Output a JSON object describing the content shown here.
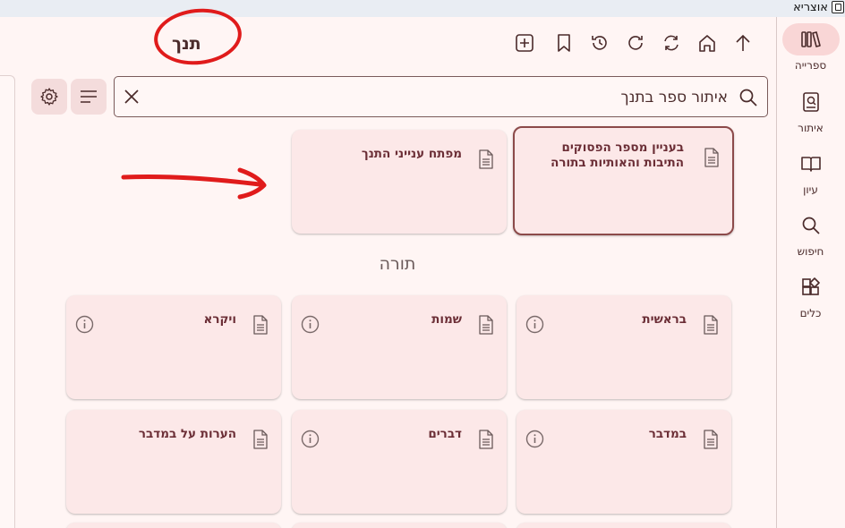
{
  "window": {
    "title": "אוצריא"
  },
  "header": {
    "title": "תנך"
  },
  "toolbar": {
    "icons": [
      "add-icon",
      "bookmark-icon",
      "history-icon",
      "refresh-icon",
      "sync-icon",
      "home-icon",
      "up-arrow-icon"
    ]
  },
  "search": {
    "placeholder": "איתור ספר בתנך"
  },
  "rail": {
    "items": [
      {
        "label": "ספרייה",
        "icon": "library-icon",
        "active": true
      },
      {
        "label": "איתור",
        "icon": "find-book-icon",
        "active": false
      },
      {
        "label": "עיון",
        "icon": "book-open-icon",
        "active": false
      },
      {
        "label": "חיפוש",
        "icon": "search-icon",
        "active": false
      },
      {
        "label": "כלים",
        "icon": "tools-icon",
        "active": false
      }
    ]
  },
  "top_cards": [
    {
      "title": "בעניין מספר הפסוקים התיבות והאותיות בתורה"
    },
    {
      "title": "מפתח ענייני התנך"
    }
  ],
  "section": {
    "title": "תורה"
  },
  "books": [
    {
      "title": "בראשית"
    },
    {
      "title": "שמות"
    },
    {
      "title": "ויקרא"
    },
    {
      "title": "במדבר"
    },
    {
      "title": "דברים"
    },
    {
      "title": "הערות על במדבר"
    }
  ],
  "colors": {
    "accent": "#6b2e36",
    "card_bg": "#fce8e8",
    "page_bg": "#fff5f4",
    "annotation": "#e01b1b"
  }
}
